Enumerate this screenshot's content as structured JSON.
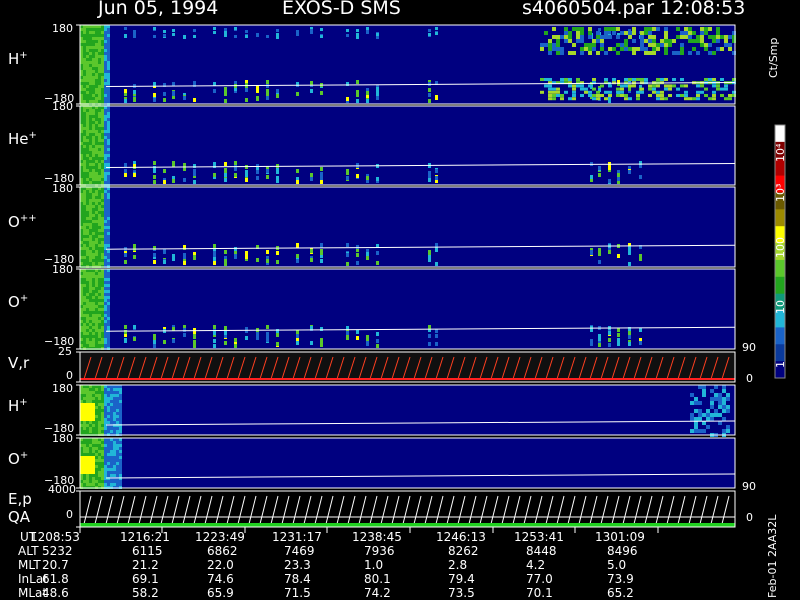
{
  "header": {
    "date": "Jun 05, 1994",
    "instrument": "EXOS-D SMS",
    "file": "s4060504.par",
    "time": "12:08:53"
  },
  "chart_data": {
    "type": "heatmap",
    "colorbar": {
      "unit": "Ct/Smp",
      "scale": "log",
      "range": [
        1,
        10000
      ],
      "ticks": [
        "1",
        "10",
        "100",
        "10³",
        "10⁴"
      ],
      "colors": [
        "#000080",
        "#0a3a9c",
        "#1a63c8",
        "#21b6d8",
        "#0f9a7a",
        "#22a51e",
        "#5bc72c",
        "#a6d82b",
        "#ffff00",
        "#9c8a00",
        "#6b5a00",
        "#ff0000",
        "#b00000",
        "#800000",
        "#ffffff"
      ]
    },
    "panels": [
      {
        "label": "H",
        "charge": "+",
        "ymax": "180",
        "ymin": "−180",
        "kind": "pitch"
      },
      {
        "label": "He",
        "charge": "+",
        "ymax": "180",
        "ymin": "−180",
        "kind": "pitch"
      },
      {
        "label": "O",
        "charge": "++",
        "ymax": "180",
        "ymin": "−180",
        "kind": "pitch"
      },
      {
        "label": "O",
        "charge": "+",
        "ymax": "180",
        "ymin": "−180",
        "kind": "pitch"
      },
      {
        "label": "V,r",
        "charge": "",
        "ymax": "25",
        "ymin": "0",
        "right_max": "90",
        "right_min": "0",
        "kind": "line"
      },
      {
        "label": "H",
        "charge": "+",
        "ymax": "180",
        "ymin": "−180",
        "kind": "pitch"
      },
      {
        "label": "O",
        "charge": "+",
        "ymax": "180",
        "ymin": "−180",
        "kind": "pitch"
      },
      {
        "label": "E,p",
        "label2": "QA",
        "charge": "",
        "ymax": "4000",
        "ymin": "0",
        "right_max": "90",
        "right_min": "0",
        "kind": "line"
      }
    ],
    "ephemeris": {
      "rows": [
        {
          "name": "UT",
          "values": [
            "1208:53",
            "1216:21",
            "1223:49",
            "1231:17",
            "1238:45",
            "1246:13",
            "1253:41",
            "1301:09"
          ]
        },
        {
          "name": "ALT",
          "values": [
            "5232",
            "6115",
            "6862",
            "7469",
            "7936",
            "8262",
            "8448",
            "8496"
          ]
        },
        {
          "name": "MLT",
          "values": [
            "20.7",
            "21.2",
            "22.0",
            "23.3",
            "1.0",
            "2.8",
            "4.2",
            "5.0"
          ]
        },
        {
          "name": "InLat",
          "values": [
            "61.8",
            "69.1",
            "74.6",
            "78.4",
            "80.1",
            "79.4",
            "77.0",
            "73.9"
          ]
        },
        {
          "name": "MLat",
          "values": [
            "48.6",
            "58.2",
            "65.9",
            "71.5",
            "74.2",
            "73.5",
            "70.1",
            "65.2"
          ]
        }
      ]
    },
    "footer_note": "Feb-01 2AA32L"
  }
}
